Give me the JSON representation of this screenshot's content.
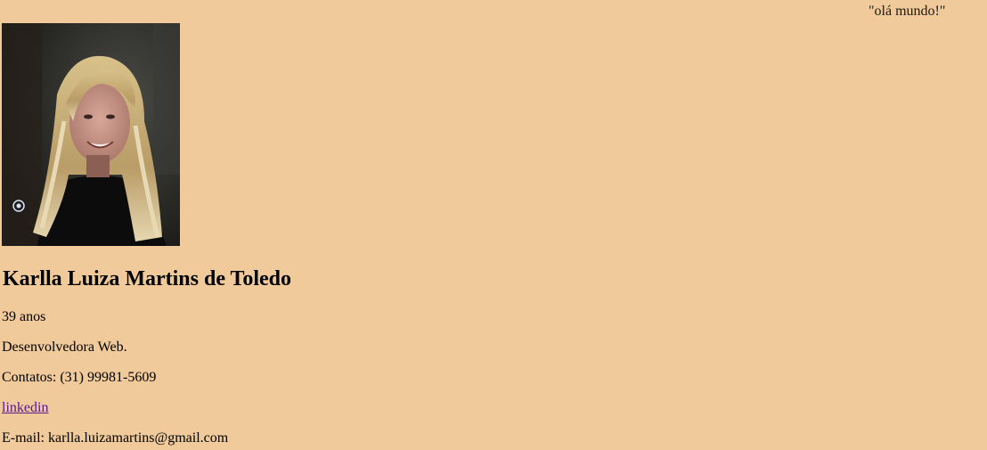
{
  "greeting": "\"olá mundo!\"",
  "profile": {
    "name": "Karlla Luiza Martins de Toledo",
    "age": "39 anos",
    "role": "Desenvolvedora Web.",
    "contacts": "Contatos: (31) 99981-5609",
    "linkedin_label": "linkedin",
    "email": "E-mail: karlla.luizamartins@gmail.com"
  },
  "colors": {
    "background": "#f0ca9a",
    "link_visited": "#551a8b"
  }
}
